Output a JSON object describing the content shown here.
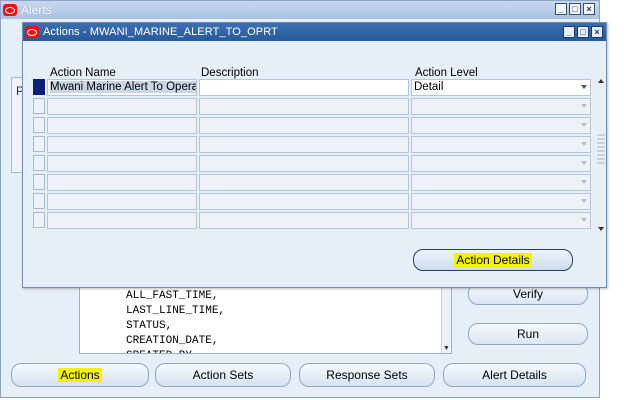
{
  "outer_window": {
    "title": "Alerts",
    "panel_letter": "P",
    "code_lines": "ALL_FAST_TIME,\nLAST_LINE_TIME,\nSTATUS,\nCREATION_DATE,\nCREATED_BY",
    "side_buttons": {
      "verify": "Verify",
      "run": "Run"
    },
    "bottom_buttons": {
      "actions": "Actions",
      "action_sets": "Action Sets",
      "response_sets": "Response Sets",
      "alert_details": "Alert Details"
    }
  },
  "actions_window": {
    "title": "Actions - MWANI_MARINE_ALERT_TO_OPRT",
    "columns": {
      "action_name": "Action Name",
      "description": "Description",
      "action_level": "Action Level"
    },
    "rows": [
      {
        "action_name": "Mwani Marine Alert To Operatoic",
        "description": "",
        "action_level": "Detail"
      },
      {
        "action_name": "",
        "description": "",
        "action_level": ""
      },
      {
        "action_name": "",
        "description": "",
        "action_level": ""
      },
      {
        "action_name": "",
        "description": "",
        "action_level": ""
      },
      {
        "action_name": "",
        "description": "",
        "action_level": ""
      },
      {
        "action_name": "",
        "description": "",
        "action_level": ""
      },
      {
        "action_name": "",
        "description": "",
        "action_level": ""
      },
      {
        "action_name": "",
        "description": "",
        "action_level": ""
      }
    ],
    "action_details_button": "Action Details"
  },
  "colors": {
    "title_bar_active": "#275a9c",
    "highlight": "#f4f400",
    "current_record": "#0b1f7a"
  },
  "icons": [
    "oracle-app-icon",
    "minimize-icon",
    "maximize-icon",
    "close-icon",
    "dropdown-arrow-icon",
    "scroll-up-icon",
    "scroll-down-icon"
  ]
}
